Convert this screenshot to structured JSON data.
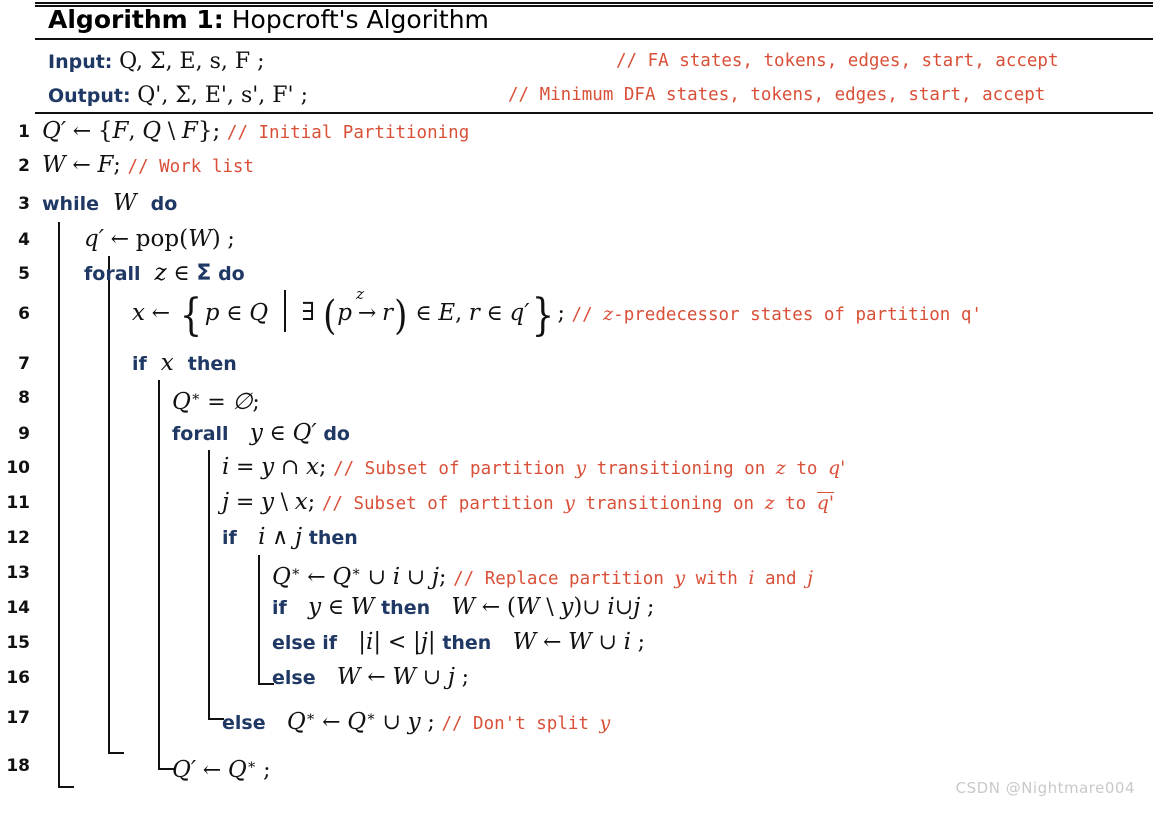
{
  "document": {
    "type": "algorithm-pseudocode-float",
    "title_prefix": "Algorithm 1:",
    "title_text": "Hopcroft's Algorithm",
    "watermark": "CSDN @Nightmare004"
  },
  "colors": {
    "text": "#111111",
    "keyword": "#1f3864",
    "comment": "#d94f38",
    "rule": "#111111",
    "watermark": "#c9c9c9",
    "background": "#ffffff"
  },
  "signature": {
    "input_label": "Input:",
    "input_value": "Q, Σ, E, s, F ;",
    "input_comment": "// FA states, tokens, edges, start, accept",
    "output_label": "Output:",
    "output_value": "Q', Σ, E', s', F' ;",
    "output_comment": "// Minimum DFA states, tokens, edges, start, accept"
  },
  "lines": [
    {
      "no": "1",
      "indent": 0,
      "code_plain": "Q' ← {F, Q \\ F};",
      "comment": "// Initial Partitioning"
    },
    {
      "no": "2",
      "indent": 0,
      "code_plain": "W ← F;",
      "comment": "// Work list"
    },
    {
      "no": "3",
      "indent": 0,
      "code_plain": "while W do",
      "comment": ""
    },
    {
      "no": "4",
      "indent": 1,
      "code_plain": "q' ← pop(W) ;",
      "comment": ""
    },
    {
      "no": "5",
      "indent": 1,
      "code_plain": "forall z ∈ Σ do",
      "comment": ""
    },
    {
      "no": "6",
      "indent": 2,
      "code_plain": "x ← { p ∈ Q | ∃ (p →z r) ∈ E, r ∈ q' };",
      "comment": "// z-predecessor states of partition q'"
    },
    {
      "no": "7",
      "indent": 2,
      "code_plain": "if x then",
      "comment": ""
    },
    {
      "no": "8",
      "indent": 3,
      "code_plain": "Q* = ∅;",
      "comment": ""
    },
    {
      "no": "9",
      "indent": 3,
      "code_plain": "forall y ∈ Q' do",
      "comment": ""
    },
    {
      "no": "10",
      "indent": 4,
      "code_plain": "i = y ∩ x;",
      "comment": "// Subset of partition y transitioning on z to q'"
    },
    {
      "no": "11",
      "indent": 4,
      "code_plain": "j = y \\ x;",
      "comment": "// Subset of partition y transitioning on z to q̅'"
    },
    {
      "no": "12",
      "indent": 4,
      "code_plain": "if i ∧ j then",
      "comment": ""
    },
    {
      "no": "13",
      "indent": 5,
      "code_plain": "Q* ← Q* ∪ i ∪ j;",
      "comment": "// Replace partition y with i and j"
    },
    {
      "no": "14",
      "indent": 5,
      "code_plain": "if y ∈ W then W ← (W \\ y) ∪ i ∪ j ;",
      "comment": ""
    },
    {
      "no": "15",
      "indent": 5,
      "code_plain": "else if |i| < |j| then W ← W ∪ i ;",
      "comment": ""
    },
    {
      "no": "16",
      "indent": 5,
      "code_plain": "else W ← W ∪ j ;",
      "comment": ""
    },
    {
      "no": "17",
      "indent": 4,
      "code_plain": "else Q* ← Q* ∪ y ;",
      "comment": "// Don't split y"
    },
    {
      "no": "18",
      "indent": 2,
      "code_plain": "Q' ← Q* ;",
      "comment": ""
    }
  ],
  "keywords": {
    "while": "while",
    "do": "do",
    "forall": "forall",
    "if": "if",
    "then": "then",
    "else": "else",
    "else_if": "else if"
  },
  "comments": {
    "c1": "// Initial Partitioning",
    "c2": "// Work list",
    "c6_pre": "// ",
    "c6_var": "z",
    "c6_post": "-predecessor states of partition q'",
    "c10_pre": "// Subset of partition ",
    "c10_y": "y",
    "c10_mid": " transitioning on ",
    "c10_z": "z",
    "c10_to": " to ",
    "c10_q": "q'",
    "c11_q": "q'",
    "c13_pre": "// Replace partition ",
    "c13_y": "y",
    "c13_mid": " with ",
    "c13_i": "i",
    "c13_and": " and ",
    "c13_j": "j",
    "c17_pre": "// Don't split ",
    "c17_y": "y"
  }
}
